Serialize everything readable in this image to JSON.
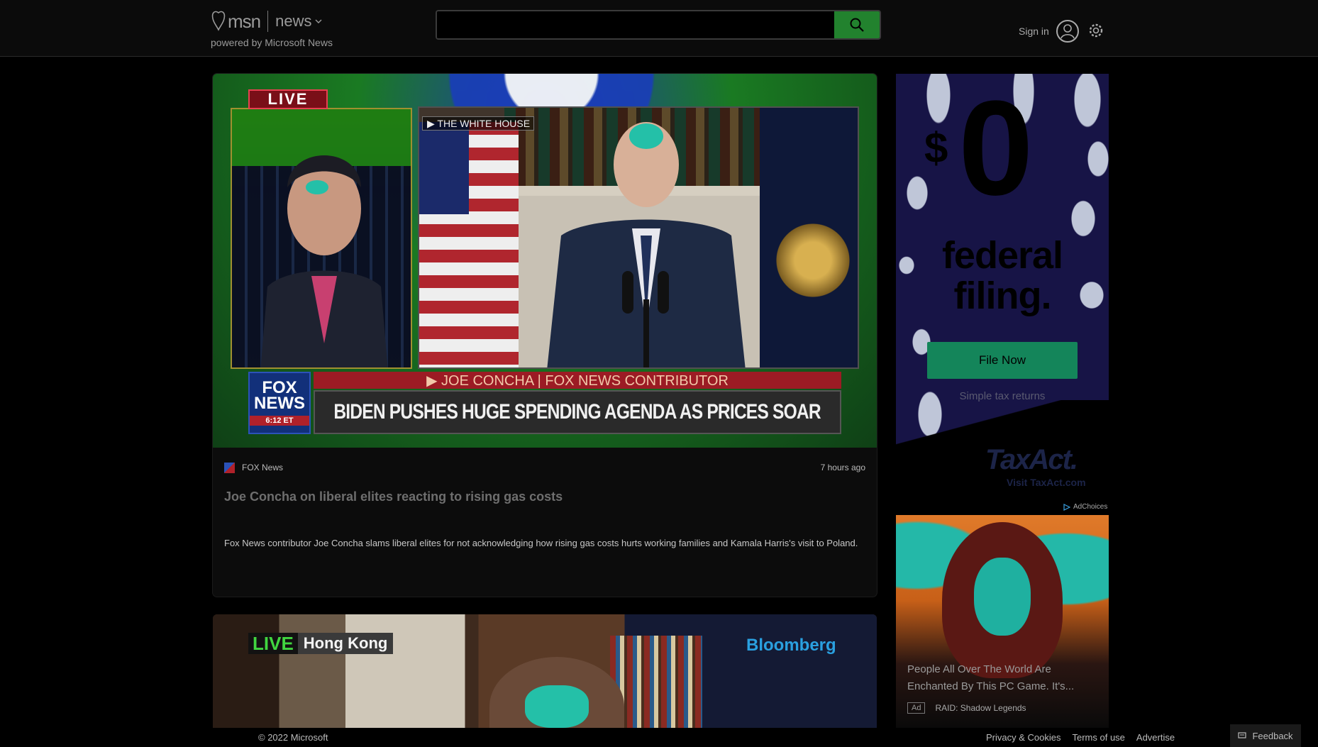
{
  "header": {
    "logo_text": "msn",
    "section": "news",
    "powered_by": "powered by Microsoft News",
    "search_value": "",
    "sign_in": "Sign in"
  },
  "main_story": {
    "live_badge": "LIVE",
    "location_tag": "▶ THE WHITE HOUSE",
    "fox_logo_line1": "FOX",
    "fox_logo_line2": "NEWS",
    "fox_logo_time": "6:12 ET",
    "chyron_top": "▶ JOE CONCHA | FOX NEWS CONTRIBUTOR",
    "chyron_main": "BIDEN PUSHES HUGE SPENDING AGENDA AS PRICES SOAR",
    "source": "FOX News",
    "time_ago": "7 hours ago",
    "headline": "Joe Concha on liberal elites reacting to rising gas costs",
    "description": "Fox News contributor Joe Concha slams liberal elites for not acknowledging how rising gas costs hurts working families and Kamala Harris's visit to Poland."
  },
  "second_story": {
    "live_label": "LIVE",
    "location": "Hong Kong",
    "network": "Bloomberg"
  },
  "ad_taxact": {
    "dollar": "$",
    "amount": "0",
    "line1": "federal",
    "line2": "filing.",
    "button": "File Now",
    "tagline": "Simple tax returns",
    "brand": "TaxAct.",
    "visit": "Visit TaxAct.com",
    "adchoices": "AdChoices"
  },
  "ad_raid": {
    "title": "People All Over The World Are Enchanted By This PC Game. It's...",
    "ad_label": "Ad",
    "advertiser": "RAID: Shadow Legends"
  },
  "footer": {
    "copyright": "© 2022 Microsoft",
    "links": [
      "Privacy & Cookies",
      "Terms of use",
      "Advertise"
    ],
    "feedback": "Feedback"
  },
  "colors": {
    "search_button": "#22822e",
    "background": "#000000",
    "file_now_button": "#14855a"
  },
  "icons": [
    "butterfly-logo-icon",
    "chevron-down-icon",
    "search-icon",
    "user-avatar-icon",
    "gear-icon",
    "adchoices-icon",
    "feedback-icon"
  ]
}
